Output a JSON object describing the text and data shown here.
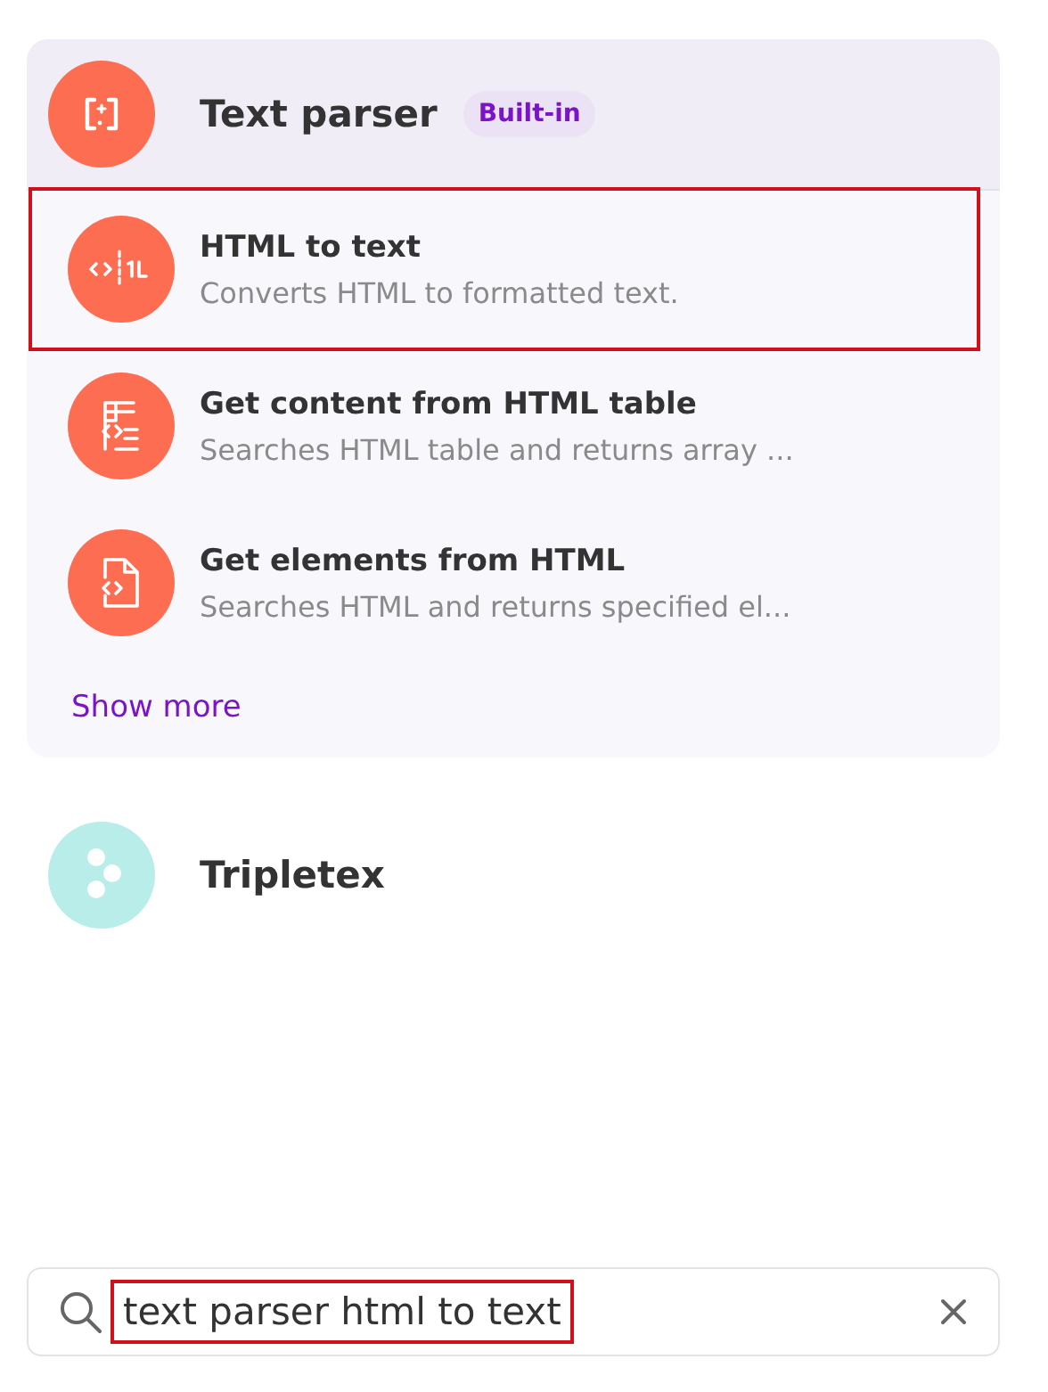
{
  "apps": [
    {
      "name": "Text parser",
      "badge": "Built-in",
      "expanded": true,
      "actions": [
        {
          "title": "HTML to text",
          "description": "Converts HTML to formatted text.",
          "highlighted": true
        },
        {
          "title": "Get content from HTML table",
          "description": "Searches HTML table and returns array ...",
          "highlighted": false
        },
        {
          "title": "Get elements from HTML",
          "description": "Searches HTML and returns specified el...",
          "highlighted": false
        }
      ],
      "show_more": "Show more"
    },
    {
      "name": "Tripletex",
      "expanded": false
    }
  ],
  "search": {
    "value": "text parser html to text",
    "highlighted": true
  }
}
